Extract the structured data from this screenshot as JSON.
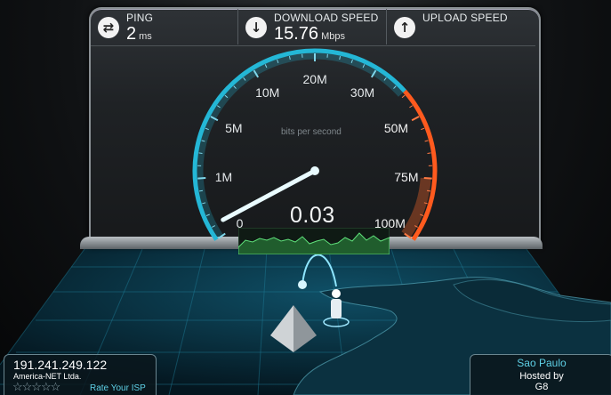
{
  "stats": {
    "ping": {
      "label": "PING",
      "value": "2",
      "unit": "ms",
      "icon": "ping-arrows-icon"
    },
    "download": {
      "label": "DOWNLOAD SPEED",
      "value": "15.76",
      "unit": "Mbps",
      "icon": "download-arrow-icon"
    },
    "upload": {
      "label": "UPLOAD SPEED",
      "value": "",
      "unit": "",
      "icon": "upload-arrow-icon"
    }
  },
  "gauge": {
    "scale_labels": [
      "0",
      "1M",
      "5M",
      "10M",
      "20M",
      "30M",
      "50M",
      "75M",
      "100M"
    ],
    "unit_caption": "bits per second",
    "reading": "0.03",
    "needle_value": 0.03
  },
  "client": {
    "ip": "191.241.249.122",
    "isp": "America-NET Ltda.",
    "rating_stars": 5,
    "rate_label": "Rate Your ISP"
  },
  "server": {
    "city": "Sao Paulo",
    "hosted_by_label": "Hosted by",
    "host": "G8"
  },
  "colors": {
    "gauge_cyan": "#25b7d6",
    "gauge_hot": "#ff5a1e",
    "graph_green": "#3fbf56",
    "accent_text": "#5ed0e6"
  }
}
